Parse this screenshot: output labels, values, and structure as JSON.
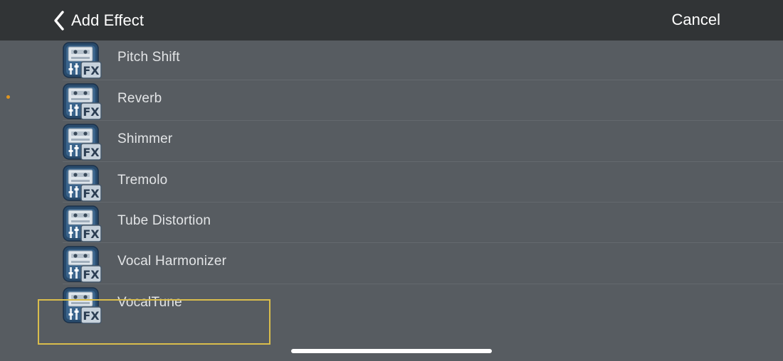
{
  "nav": {
    "title": "Add Effect",
    "cancel_label": "Cancel"
  },
  "effects": [
    {
      "label": ""
    },
    {
      "label": "Pitch Shift"
    },
    {
      "label": "Reverb"
    },
    {
      "label": "Shimmer"
    },
    {
      "label": "Tremolo"
    },
    {
      "label": "Tube Distortion"
    },
    {
      "label": "Vocal Harmonizer"
    },
    {
      "label": "VocalTune"
    }
  ],
  "icon": {
    "name": "fx-plugin-icon",
    "badge_text": "FX"
  },
  "selected": "VocalTune",
  "colors": {
    "nav_bg": "#313436",
    "list_bg": "#575c61",
    "text": "#e3e5e7",
    "selection": "#d9bd4c",
    "indicator_dot": "#e0951f"
  }
}
